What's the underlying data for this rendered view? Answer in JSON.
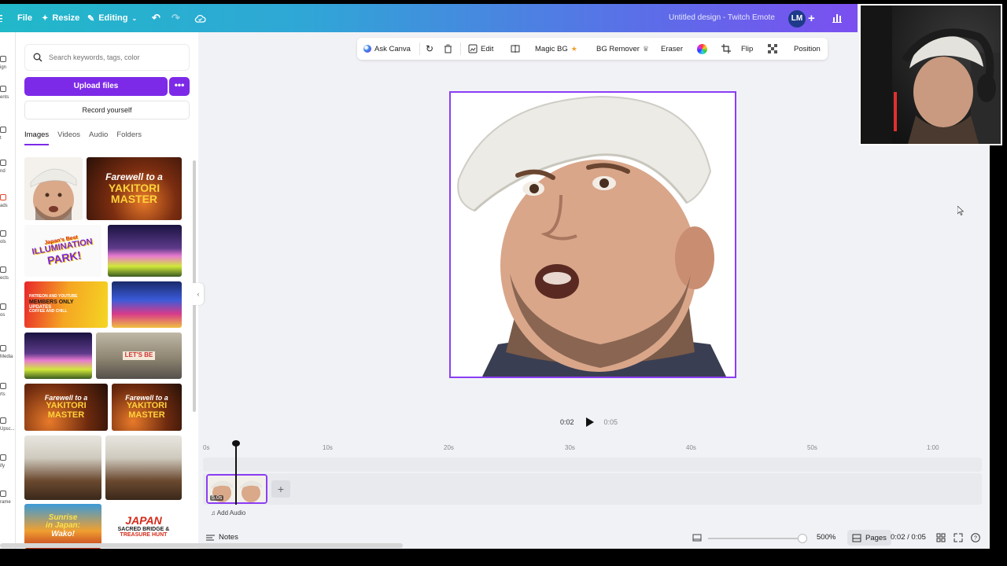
{
  "topbar": {
    "file_label": "File",
    "resize_label": "Resize",
    "editing_label": "Editing",
    "design_title": "Untitled design - Twitch Emote",
    "avatar_initials": "LM"
  },
  "rail": {
    "items": [
      "ign",
      "ents",
      "t",
      "nd",
      "ads",
      "ols",
      "ects",
      "os",
      "Media",
      "rts",
      "Upsc...",
      "ify",
      "rame"
    ]
  },
  "panel": {
    "search_placeholder": "Search keywords, tags, color",
    "upload_label": "Upload files",
    "more_label": "•••",
    "record_label": "Record yourself",
    "tabs": [
      {
        "label": "Images",
        "active": true
      },
      {
        "label": "Videos",
        "active": false
      },
      {
        "label": "Audio",
        "active": false
      },
      {
        "label": "Folders",
        "active": false
      }
    ],
    "thumbs": {
      "yakitori_line1": "Farewell to a",
      "yakitori_line2": "YAKITORI",
      "yakitori_line3": "MASTER",
      "illum_line1": "Japan's Best",
      "illum_line2": "ILLUMINATION",
      "illum_line3": "PARK!",
      "members_line1": "PATREON AND YOUTUBE",
      "members_line2": "MEMBERS ONLY",
      "members_line3": "UPDATES",
      "members_line4": "COFFEE AND CHILL",
      "desk_text": "LET'S BE",
      "sunrise_line1": "Sunrise",
      "sunrise_line2": "in Japan:",
      "sunrise_line3": "Wako!",
      "japan_line1": "JAPAN",
      "japan_line2": "SACRED BRIDGE &",
      "japan_line3": "TREASURE HUNT"
    }
  },
  "context_toolbar": {
    "ask_canva": "Ask Canva",
    "edit": "Edit",
    "magic_bg": "Magic BG",
    "bg_remover": "BG Remover",
    "eraser": "Eraser",
    "flip": "Flip",
    "position": "Position"
  },
  "playback": {
    "current": "0:02",
    "duration": "0:05"
  },
  "timeline": {
    "ticks": [
      "0s",
      "10s",
      "20s",
      "30s",
      "40s",
      "50s",
      "1:00"
    ],
    "clip_duration": "5.0s",
    "add_audio": "Add Audio"
  },
  "bottombar": {
    "notes": "Notes",
    "zoom": "500%",
    "pages": "Pages",
    "page_info": "0:02 / 0:05"
  },
  "colors": {
    "accent": "#7d2ae8",
    "selection": "#8b3df5",
    "topbar_start": "#21b8c9",
    "topbar_end": "#7b4ff0"
  }
}
